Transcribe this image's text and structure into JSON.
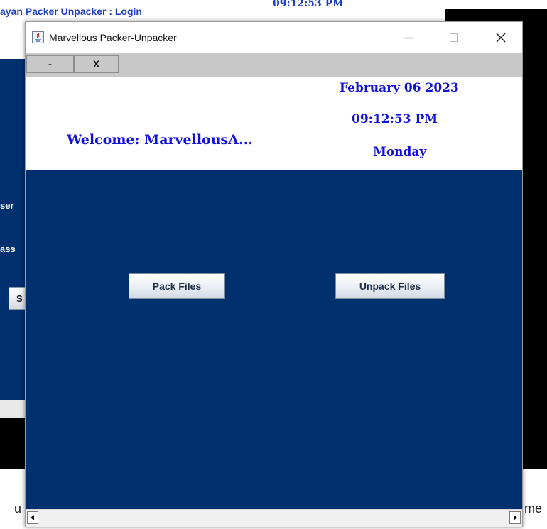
{
  "background": {
    "login_title": "ayan Packer Unpacker : Login",
    "clock_partial": "09:12:53 PM",
    "labels": [
      "ser",
      "ass"
    ],
    "button_partial": "S",
    "bottom_left": "u",
    "bottom_right": "me"
  },
  "window": {
    "title": "Marvellous Packer-Unpacker",
    "controls": {
      "minimize": "—",
      "maximize": "☐",
      "close": "✕"
    }
  },
  "menubar": {
    "minimize_label": "-",
    "close_label": "X"
  },
  "header": {
    "date": "February 06 2023",
    "time": "09:12:53 PM",
    "day": "Monday",
    "welcome": "Welcome: MarvellousA..."
  },
  "main": {
    "pack_button": "Pack Files",
    "unpack_button": "Unpack Files",
    "background_color": "#00306e"
  },
  "scrollbar": {
    "left_arrow": "◀",
    "right_arrow": "▶"
  }
}
